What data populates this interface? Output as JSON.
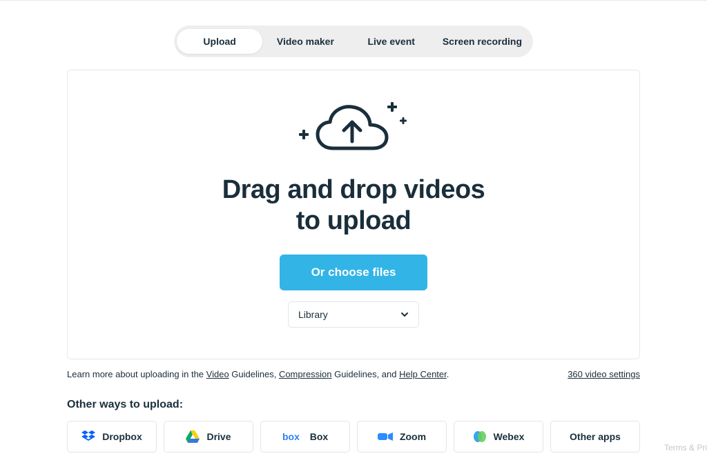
{
  "tabs": {
    "upload": "Upload",
    "video_maker": "Video maker",
    "live_event": "Live event",
    "screen_recording": "Screen recording"
  },
  "drop": {
    "headline_line1": "Drag and drop videos",
    "headline_line2": "to upload",
    "choose_button": "Or choose files",
    "destination_selected": "Library"
  },
  "help": {
    "prefix": "Learn more about uploading in the ",
    "video_link": "Video",
    "video_suffix": " Guidelines, ",
    "compression_link": "Compression",
    "compression_suffix": " Guidelines, and ",
    "help_center_link": "Help Center",
    "end": ".",
    "settings_link": "360 video settings"
  },
  "other": {
    "title": "Other ways to upload:",
    "dropbox": "Dropbox",
    "drive": "Drive",
    "box": "Box",
    "zoom": "Zoom",
    "webex": "Webex",
    "other_apps": "Other apps"
  },
  "footer": {
    "terms": "Terms & Pri"
  },
  "colors": {
    "primary_button": "#32b4e6",
    "text_dark": "#1a2e3b"
  }
}
